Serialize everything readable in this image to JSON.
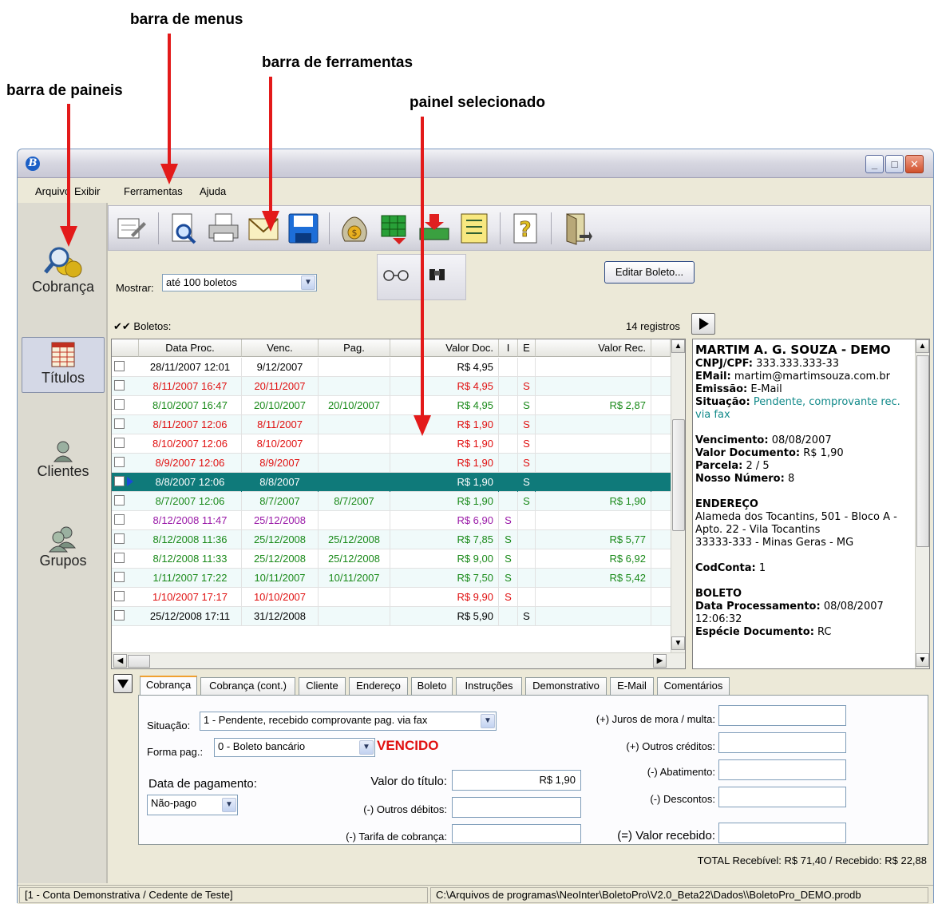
{
  "annotations": {
    "menus": "barra de menus",
    "ferramentas": "barra de ferramentas",
    "paineis": "barra de paineis",
    "selecionado": "painel selecionado"
  },
  "window": {
    "app_icon": "B"
  },
  "menu": [
    "Arquivo",
    "Exibir",
    "Ferramentas",
    "Ajuda"
  ],
  "panels": [
    {
      "label": "Cobrança",
      "icon": "money-search-icon"
    },
    {
      "label": "Títulos",
      "icon": "grid-table-icon"
    },
    {
      "label": "Clientes",
      "icon": "person-icon"
    },
    {
      "label": "Grupos",
      "icon": "people-icon"
    }
  ],
  "toolbar_icons": [
    "edit-form-icon",
    "preview-icon",
    "print-icon",
    "email-icon",
    "save-icon",
    "money-bag-icon",
    "grid-transfer-icon",
    "inbox-download-icon",
    "report-icon",
    "help-icon",
    "exit-icon"
  ],
  "filter": {
    "show_label": "Mostrar:",
    "show_value": "até 100 boletos",
    "edit_button": "Editar Boleto...",
    "list_title": "Boletos:",
    "records": "14 registros"
  },
  "grid": {
    "columns": [
      "Data Proc.",
      "Venc.",
      "Pag.",
      "Valor Doc.",
      "I",
      "E",
      "Valor Rec."
    ],
    "rows": [
      {
        "proc": "28/11/2007 12:01",
        "venc": "9/12/2007",
        "pag": "",
        "valor": "R$ 4,95",
        "i": "",
        "e": "",
        "rec": "",
        "color": "#000000"
      },
      {
        "proc": "8/11/2007 16:47",
        "venc": "20/11/2007",
        "pag": "",
        "valor": "R$ 4,95",
        "i": "",
        "e": "S",
        "rec": "",
        "color": "#e01010"
      },
      {
        "proc": "8/10/2007 16:47",
        "venc": "20/10/2007",
        "pag": "20/10/2007",
        "valor": "R$ 4,95",
        "i": "",
        "e": "S",
        "rec": "R$ 2,87",
        "color": "#1a8a1a"
      },
      {
        "proc": "8/11/2007 12:06",
        "venc": "8/11/2007",
        "pag": "",
        "valor": "R$ 1,90",
        "i": "",
        "e": "S",
        "rec": "",
        "color": "#e01010"
      },
      {
        "proc": "8/10/2007 12:06",
        "venc": "8/10/2007",
        "pag": "",
        "valor": "R$ 1,90",
        "i": "",
        "e": "S",
        "rec": "",
        "color": "#e01010"
      },
      {
        "proc": "8/9/2007 12:06",
        "venc": "8/9/2007",
        "pag": "",
        "valor": "R$ 1,90",
        "i": "",
        "e": "S",
        "rec": "",
        "color": "#e01010"
      },
      {
        "proc": "8/8/2007 12:06",
        "venc": "8/8/2007",
        "pag": "",
        "valor": "R$ 1,90",
        "i": "",
        "e": "S",
        "rec": "",
        "color": "#ffffff",
        "selected": true
      },
      {
        "proc": "8/7/2007 12:06",
        "venc": "8/7/2007",
        "pag": "8/7/2007",
        "valor": "R$ 1,90",
        "i": "",
        "e": "S",
        "rec": "R$ 1,90",
        "color": "#1a8a1a"
      },
      {
        "proc": "8/12/2008 11:47",
        "venc": "25/12/2008",
        "pag": "",
        "valor": "R$ 6,90",
        "i": "S",
        "e": "",
        "rec": "",
        "color": "#9a1aa8"
      },
      {
        "proc": "8/12/2008 11:36",
        "venc": "25/12/2008",
        "pag": "25/12/2008",
        "valor": "R$ 7,85",
        "i": "S",
        "e": "",
        "rec": "R$ 5,77",
        "color": "#1a8a1a"
      },
      {
        "proc": "8/12/2008 11:33",
        "venc": "25/12/2008",
        "pag": "25/12/2008",
        "valor": "R$ 9,00",
        "i": "S",
        "e": "",
        "rec": "R$ 6,92",
        "color": "#1a8a1a"
      },
      {
        "proc": "1/11/2007 17:22",
        "venc": "10/11/2007",
        "pag": "10/11/2007",
        "valor": "R$ 7,50",
        "i": "S",
        "e": "",
        "rec": "R$ 5,42",
        "color": "#1a8a1a"
      },
      {
        "proc": "1/10/2007 17:17",
        "venc": "10/10/2007",
        "pag": "",
        "valor": "R$ 9,90",
        "i": "S",
        "e": "",
        "rec": "",
        "color": "#e01010"
      },
      {
        "proc": "25/12/2008 17:11",
        "venc": "31/12/2008",
        "pag": "",
        "valor": "R$ 5,90",
        "i": "",
        "e": "S",
        "rec": "",
        "color": "#000000"
      }
    ]
  },
  "detail": {
    "name": "MARTIM A. G. SOUZA - DEMO",
    "cnpj_label": "CNPJ/CPF:",
    "cnpj": "333.333.333-33",
    "email_label": "EMail:",
    "email": "martim@martimsouza.com.br",
    "emissao_label": "Emissão:",
    "emissao": "E-Mail",
    "situacao_label": "Situação:",
    "situacao": "Pendente, comprovante rec. via fax",
    "venc_label": "Vencimento:",
    "venc": "08/08/2007",
    "valor_label": "Valor Documento:",
    "valor": "R$ 1,90",
    "parcela_label": "Parcela:",
    "parcela": "2 / 5",
    "nosso_label": "Nosso Número:",
    "nosso": "8",
    "endereco_title": "ENDEREÇO",
    "endereco_1": "Alameda dos Tocantins, 501 - Bloco A -",
    "endereco_2": "Apto. 22 - Vila Tocantins",
    "endereco_3": "33333-333 - Minas Geras - MG",
    "codconta_label": "CodConta:",
    "codconta": "1",
    "boleto_title": "BOLETO",
    "dataproc_label": "Data Processamento:",
    "dataproc": "08/08/2007",
    "dataproc_time": "12:06:32",
    "especie_label": "Espécie Documento:",
    "especie": "RC"
  },
  "tabs": [
    "Cobrança",
    "Cobrança (cont.)",
    "Cliente",
    "Endereço",
    "Boleto",
    "Instruções",
    "Demonstrativo",
    "E-Mail",
    "Comentários"
  ],
  "form": {
    "situacao_label": "Situação:",
    "situacao_value": "1 - Pendente, recebido comprovante pag. via fax",
    "forma_label": "Forma pag.:",
    "forma_value": "0 - Boleto bancário",
    "vencido": "VENCIDO",
    "data_pag_label": "Data de pagamento:",
    "data_pag_value": "Não-pago",
    "valor_titulo_label": "Valor do título:",
    "valor_titulo": "R$ 1,90",
    "outros_debitos_label": "(-) Outros débitos:",
    "tarifa_label": "(-) Tarifa de cobrança:",
    "juros_label": "(+) Juros de mora / multa:",
    "outros_creditos_label": "(+) Outros créditos:",
    "abatimento_label": "(-) Abatimento:",
    "descontos_label": "(-) Descontos:",
    "valor_recebido_label": "(=) Valor recebido:"
  },
  "totals": "TOTAL Recebível: R$ 71,40 / Recebido: R$ 22,88",
  "status": {
    "left": "[1 - Conta Demonstrativa / Cedente de Teste]",
    "right": "C:\\Arquivos de programas\\NeoInter\\BoletoPro\\V2.0_Beta22\\Dados\\\\BoletoPro_DEMO.prodb"
  },
  "colors": {
    "selected_row": "#0f7a7a",
    "arrow": "#e31a1a",
    "vencido": "#e01010",
    "situacao_text": "#128a8a"
  }
}
